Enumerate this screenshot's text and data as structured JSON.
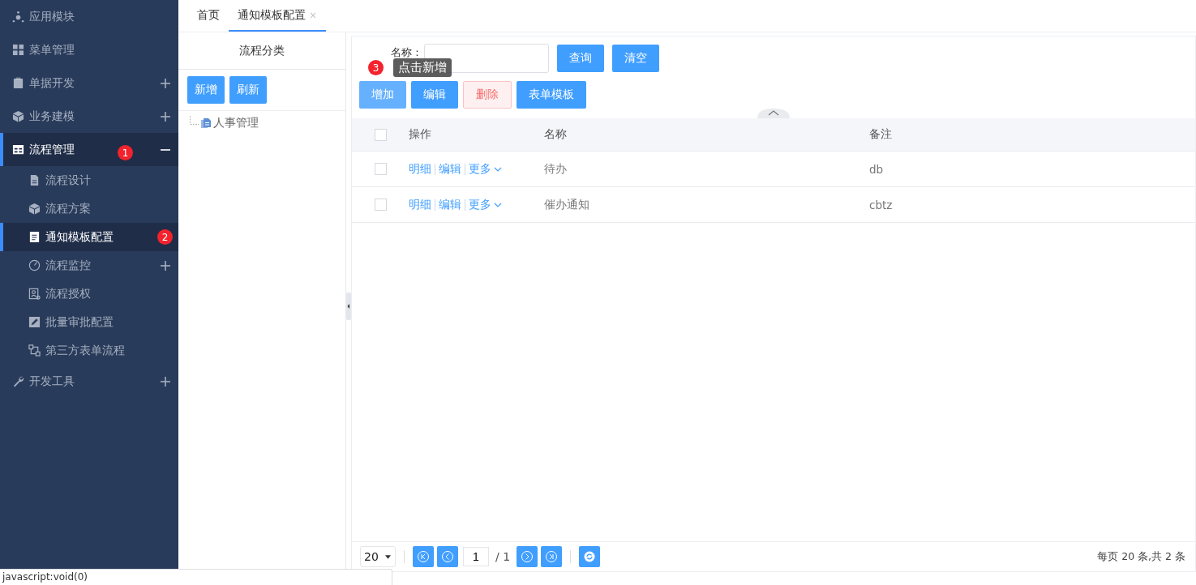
{
  "sidebar": {
    "items": [
      {
        "label": "应用模块",
        "selected": false
      },
      {
        "label": "菜单管理",
        "selected": false
      },
      {
        "label": "单据开发",
        "selected": false,
        "expanded": false
      },
      {
        "label": "业务建模",
        "selected": false,
        "expanded": false
      },
      {
        "label": "流程管理",
        "selected": true,
        "expanded": true,
        "badge": "1",
        "children": [
          {
            "label": "流程设计",
            "selected": false
          },
          {
            "label": "流程方案",
            "selected": false
          },
          {
            "label": "通知模板配置",
            "selected": true,
            "badge": "2"
          },
          {
            "label": "流程监控",
            "selected": false,
            "expanded": false
          },
          {
            "label": "流程授权",
            "selected": false
          },
          {
            "label": "批量审批配置",
            "selected": false
          },
          {
            "label": "第三方表单流程",
            "selected": false
          }
        ]
      },
      {
        "label": "开发工具",
        "selected": false,
        "expanded": false
      }
    ]
  },
  "tabs": [
    {
      "label": "首页",
      "selected": false
    },
    {
      "label": "通知模板配置",
      "selected": true,
      "close": "×"
    }
  ],
  "category_panel": {
    "title": "流程分类",
    "buttons": [
      "新增",
      "刷新"
    ],
    "tree": [
      {
        "label": "人事管理"
      }
    ]
  },
  "search": {
    "label": "名称：",
    "buttons": [
      "查询",
      "清空"
    ]
  },
  "toolbar": [
    {
      "label": "增加",
      "kind": "light"
    },
    {
      "label": "编辑",
      "kind": "primary"
    },
    {
      "label": "删除",
      "kind": "danger"
    },
    {
      "label": "表单模板",
      "kind": "primary"
    }
  ],
  "tooltip": {
    "badge": "3",
    "text": "点击新增"
  },
  "table": {
    "header_checked": false,
    "columns": [
      "操作",
      "名称",
      "备注"
    ],
    "rows": [
      {
        "checked": false,
        "actions": [
          "明细",
          "编辑",
          "更多"
        ],
        "name": "待办",
        "note": "db"
      },
      {
        "checked": false,
        "actions": [
          "明细",
          "编辑",
          "更多"
        ],
        "name": "催办通知",
        "note": "cbtz"
      }
    ]
  },
  "pagination": {
    "page_size": "20",
    "page": "1",
    "total_pages": "/ 1",
    "summary": "每页 20 条,共 2 条"
  },
  "status_bar": "javascript:void(0)"
}
